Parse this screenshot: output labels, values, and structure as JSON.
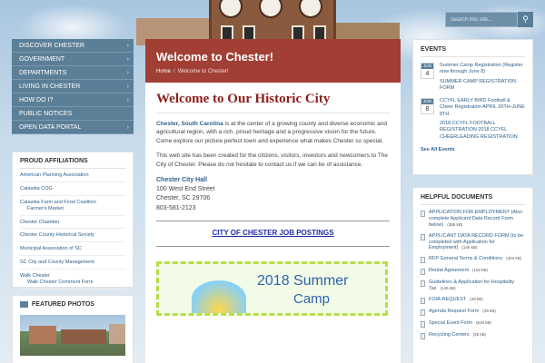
{
  "search": {
    "placeholder": "Search this site...",
    "button_icon": "search-icon"
  },
  "nav": {
    "items": [
      {
        "label": "DISCOVER CHESTER"
      },
      {
        "label": "GOVERNMENT"
      },
      {
        "label": "DEPARTMENTS"
      },
      {
        "label": "LIVING IN CHESTER"
      },
      {
        "label": "HOW DO I?"
      },
      {
        "label": "PUBLIC NOTICES"
      },
      {
        "label": "OPEN DATA PORTAL"
      }
    ]
  },
  "affiliations": {
    "title": "PROUD AFFILIATIONS",
    "links": [
      {
        "label": "American Planning Association",
        "sub": ""
      },
      {
        "label": "Catawba COG",
        "sub": ""
      },
      {
        "label": "Catawba Farm and Food Coalition",
        "sub": "Farmer's Market"
      },
      {
        "label": "Chester Chamber",
        "sub": ""
      },
      {
        "label": "Chester County Historical Society",
        "sub": ""
      },
      {
        "label": "Municipal Association of SC",
        "sub": ""
      },
      {
        "label": "SC City and County Management",
        "sub": ""
      },
      {
        "label": "Walk Chester",
        "sub": "Walk Chester Comment Form"
      }
    ]
  },
  "photos": {
    "title": "FEATURED PHOTOS"
  },
  "banner": {
    "title": "Welcome to Chester!",
    "crumb_home": "Home",
    "crumb_sep": "/",
    "crumb_current": "Welcome to Chester!"
  },
  "content": {
    "heading": "Welcome to Our Historic City",
    "intro_highlight": "Chester, South Carolina",
    "intro_rest": " is at the center of a growing county and diverse economic and agricultural region, with a rich, proud heritage and a progressive vision for the future. Come explore our picture perfect town and experience what makes Chester so special.",
    "para2": "This web site has been created for the citizens, visitors, investors and newcomers to The City of Chester.  Please do not hesitate to contact us if we can be of assistance.",
    "city_hall_title": "Chester City Hall",
    "address1": "100 West End Street",
    "address2": "Chester, SC 29706",
    "phone": "803-581-2123",
    "jobs_link": "CITY OF CHESTER JOB POSTINGS",
    "flyer_title": "2018 Summer",
    "flyer_sub": "Camp"
  },
  "events": {
    "title": "EVENTS",
    "items": [
      {
        "month": "JUN",
        "day": "4",
        "link": "Summer Camp Registration (Register now through June 8)",
        "desc": "SUMMER CAMP REGISTRATION FORM"
      },
      {
        "month": "JUN",
        "day": "8",
        "link": "CCYFL EARLY BIRD Football & Cheer Registration APRIL 30TH-JUNE 8TH",
        "desc": "2018 CCYFL FOOTBALL REGISTRATION 2018 CCYFL CHEERLEADING REGISTRATION"
      }
    ],
    "see_all": "See All Events"
  },
  "docs": {
    "title": "HELPFUL DOCUMENTS",
    "items": [
      {
        "label": "APPLICATION FOR EMPLOYMENT (Also complete Applicant Data Record Form below)",
        "size": "(385 kB)"
      },
      {
        "label": "APPLICANT DATA RECORD FORM (to be completed with Application for Employment)",
        "size": "(145 kB)"
      },
      {
        "label": "RFP General Terms & Conditions",
        "size": "(303 kB)"
      },
      {
        "label": "Rental Agreement",
        "size": "(192 kB)"
      },
      {
        "label": "Guidelines & Application for Hospitality Tax",
        "size": "(145 kB)"
      },
      {
        "label": "FOIA-REQUEST",
        "size": "(49 kB)"
      },
      {
        "label": "Agenda Request Form",
        "size": "(39 kB)"
      },
      {
        "label": "Special Event Form",
        "size": "(619 kB)"
      },
      {
        "label": "Recycling Centers",
        "size": "(39 kB)"
      }
    ]
  },
  "colors": {
    "nav_bg": "#5c7f98",
    "banner_bg": "#972a1e",
    "heading_red": "#8b1e1a",
    "link_blue": "#2d5f89"
  }
}
